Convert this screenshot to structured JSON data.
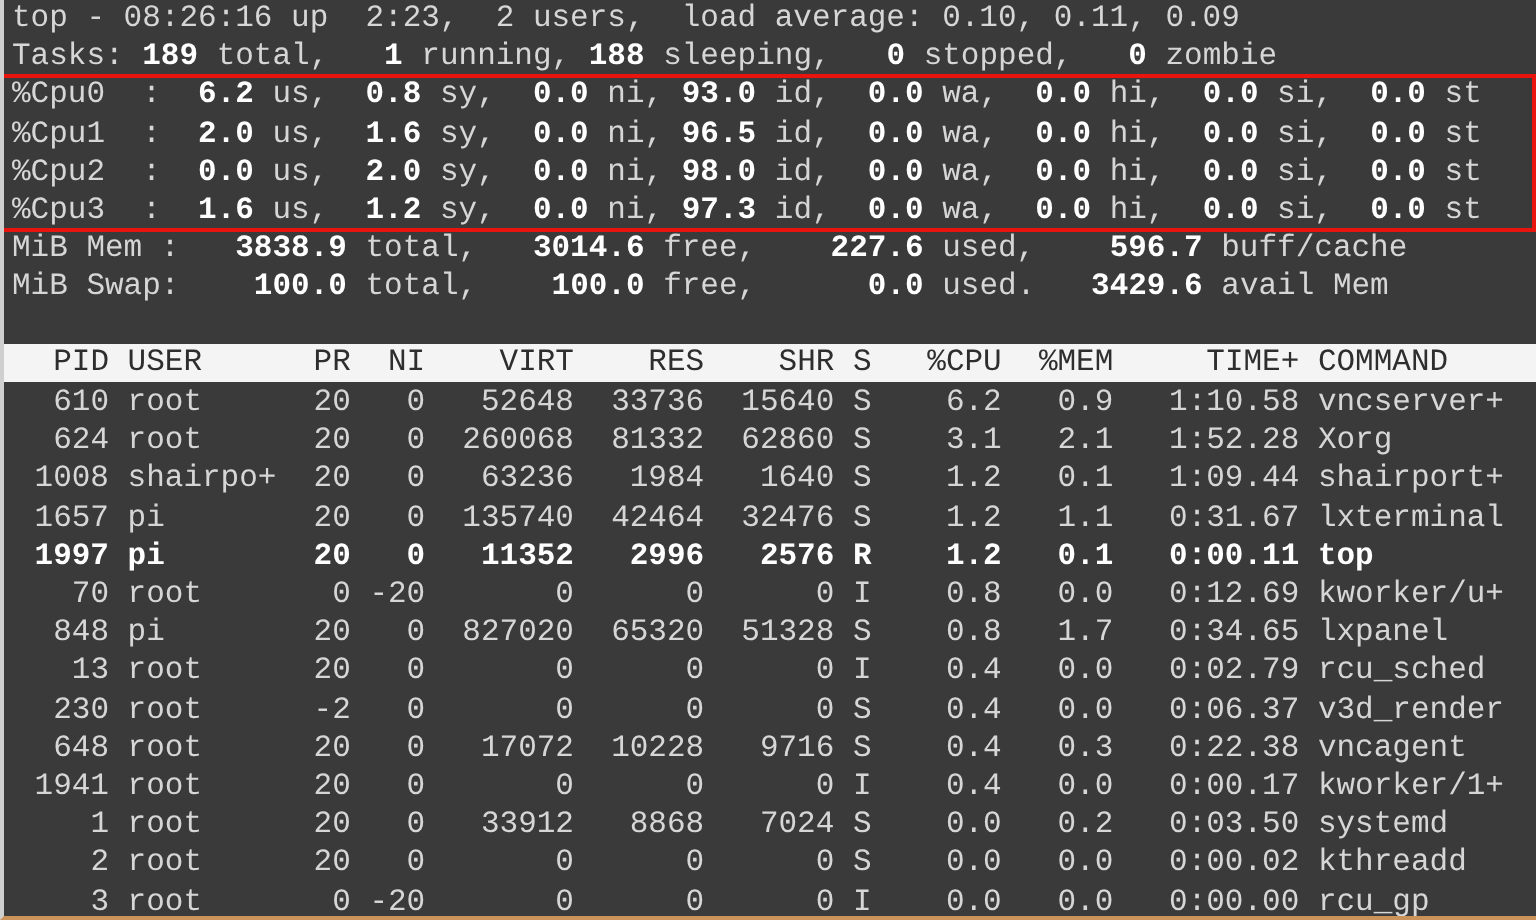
{
  "summary": {
    "uptime_line": "top - 08:26:16 up  2:23,  2 users,  load average: 0.10, 0.11, 0.09",
    "tasks_line": "Tasks: **189** total,   **1** running, **188** sleeping,   **0** stopped,   **0** zombie",
    "cpu_block": {
      "highlighted": true,
      "lines": [
        "%Cpu0  :  **6.2** us,  **0.8** sy,  **0.0** ni, **93.0** id,  **0.0** wa,  **0.0** hi,  **0.0** si,  **0.0** st",
        "%Cpu1  :  **2.0** us,  **1.6** sy,  **0.0** ni, **96.5** id,  **0.0** wa,  **0.0** hi,  **0.0** si,  **0.0** st",
        "%Cpu2  :  **0.0** us,  **2.0** sy,  **0.0** ni, **98.0** id,  **0.0** wa,  **0.0** hi,  **0.0** si,  **0.0** st",
        "%Cpu3  :  **1.6** us,  **1.2** sy,  **0.0** ni, **97.3** id,  **0.0** wa,  **0.0** hi,  **0.0** si,  **0.0** st"
      ]
    },
    "mem_line": "MiB Mem :   **3838.9** total,   **3014.6** free,    **227.6** used,    **596.7** buff/cache",
    "swap_line": "MiB Swap:    **100.0** total,    **100.0** free,      **0.0** used.   **3429.6** avail Mem"
  },
  "table": {
    "columns": [
      "PID",
      "USER",
      "PR",
      "NI",
      "VIRT",
      "RES",
      "SHR",
      "S",
      "%CPU",
      "%MEM",
      "TIME+",
      "COMMAND"
    ],
    "rows": [
      {
        "bold": false,
        "cells": [
          "610",
          "root",
          "20",
          "0",
          "52648",
          "33736",
          "15640",
          "S",
          "6.2",
          "0.9",
          "1:10.58",
          "vncserver+"
        ]
      },
      {
        "bold": false,
        "cells": [
          "624",
          "root",
          "20",
          "0",
          "260068",
          "81332",
          "62860",
          "S",
          "3.1",
          "2.1",
          "1:52.28",
          "Xorg"
        ]
      },
      {
        "bold": false,
        "cells": [
          "1008",
          "shairpo+",
          "20",
          "0",
          "63236",
          "1984",
          "1640",
          "S",
          "1.2",
          "0.1",
          "1:09.44",
          "shairport+"
        ]
      },
      {
        "bold": false,
        "cells": [
          "1657",
          "pi",
          "20",
          "0",
          "135740",
          "42464",
          "32476",
          "S",
          "1.2",
          "1.1",
          "0:31.67",
          "lxterminal"
        ]
      },
      {
        "bold": true,
        "cells": [
          "1997",
          "pi",
          "20",
          "0",
          "11352",
          "2996",
          "2576",
          "R",
          "1.2",
          "0.1",
          "0:00.11",
          "top"
        ]
      },
      {
        "bold": false,
        "cells": [
          "70",
          "root",
          "0",
          "-20",
          "0",
          "0",
          "0",
          "I",
          "0.8",
          "0.0",
          "0:12.69",
          "kworker/u+"
        ]
      },
      {
        "bold": false,
        "cells": [
          "848",
          "pi",
          "20",
          "0",
          "827020",
          "65320",
          "51328",
          "S",
          "0.8",
          "1.7",
          "0:34.65",
          "lxpanel"
        ]
      },
      {
        "bold": false,
        "cells": [
          "13",
          "root",
          "20",
          "0",
          "0",
          "0",
          "0",
          "I",
          "0.4",
          "0.0",
          "0:02.79",
          "rcu_sched"
        ]
      },
      {
        "bold": false,
        "cells": [
          "230",
          "root",
          "-2",
          "0",
          "0",
          "0",
          "0",
          "S",
          "0.4",
          "0.0",
          "0:06.37",
          "v3d_render"
        ]
      },
      {
        "bold": false,
        "cells": [
          "648",
          "root",
          "20",
          "0",
          "17072",
          "10228",
          "9716",
          "S",
          "0.4",
          "0.3",
          "0:22.38",
          "vncagent"
        ]
      },
      {
        "bold": false,
        "cells": [
          "1941",
          "root",
          "20",
          "0",
          "0",
          "0",
          "0",
          "I",
          "0.4",
          "0.0",
          "0:00.17",
          "kworker/1+"
        ]
      },
      {
        "bold": false,
        "cells": [
          "1",
          "root",
          "20",
          "0",
          "33912",
          "8868",
          "7024",
          "S",
          "0.0",
          "0.2",
          "0:03.50",
          "systemd"
        ]
      },
      {
        "bold": false,
        "cells": [
          "2",
          "root",
          "20",
          "0",
          "0",
          "0",
          "0",
          "S",
          "0.0",
          "0.0",
          "0:00.02",
          "kthreadd"
        ]
      },
      {
        "bold": false,
        "cells": [
          "3",
          "root",
          "0",
          "-20",
          "0",
          "0",
          "0",
          "I",
          "0.0",
          "0.0",
          "0:00.00",
          "rcu_gp"
        ]
      }
    ]
  }
}
